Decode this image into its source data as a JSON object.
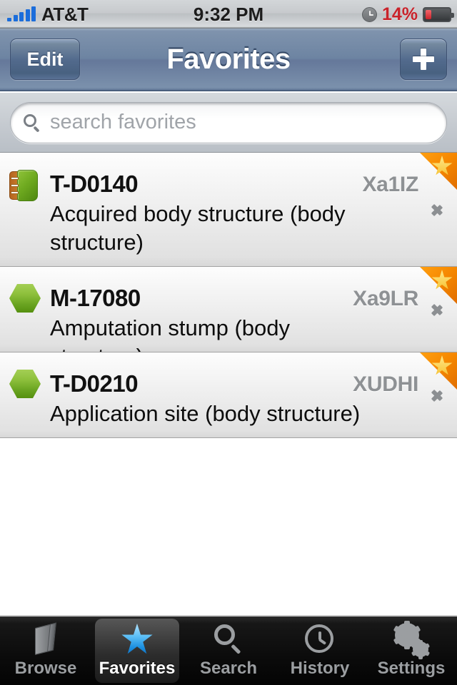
{
  "statusbar": {
    "carrier": "AT&T",
    "time": "9:32 PM",
    "battery_percent": "14%",
    "signal_bars": 5,
    "alarm_icon": "clock-icon",
    "battery_color": "#c9232b"
  },
  "navbar": {
    "edit_label": "Edit",
    "title": "Favorites",
    "add_label": "+"
  },
  "search": {
    "placeholder": "search favorites",
    "value": "",
    "icon": "search-icon"
  },
  "list": {
    "rows": [
      {
        "icon": "notebook-icon",
        "code": "T-D0140",
        "tag": "Xa1IZ",
        "description": "Acquired body structure (body structure)",
        "favorite": true,
        "disclosure": "chevron-right-icon"
      },
      {
        "icon": "hexagon-icon",
        "code": "M-17080",
        "tag": "Xa9LR",
        "description": "Amputation stump (body structure)",
        "favorite": true,
        "disclosure": "chevron-right-icon"
      },
      {
        "icon": "hexagon-icon",
        "code": "T-D0210",
        "tag": "XUDHI",
        "description": "Application site (body structure)",
        "favorite": true,
        "disclosure": "chevron-right-icon"
      }
    ]
  },
  "tabbar": {
    "selected": "Favorites",
    "tabs": [
      {
        "label": "Browse",
        "icon": "book-icon"
      },
      {
        "label": "Favorites",
        "icon": "star-icon"
      },
      {
        "label": "Search",
        "icon": "search-icon"
      },
      {
        "label": "History",
        "icon": "clock-icon"
      },
      {
        "label": "Settings",
        "icon": "gear-icon"
      }
    ]
  },
  "colors": {
    "accent_blue": "#3aa0e8",
    "favorite_orange": "#f58700",
    "icon_green": "#6ba522",
    "nav_blue": "#6d84a2"
  }
}
